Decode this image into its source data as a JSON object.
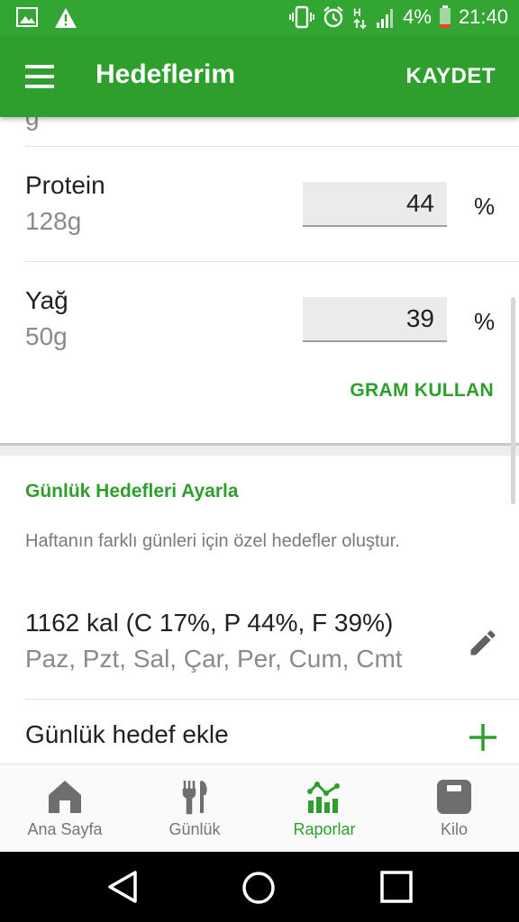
{
  "status": {
    "battery": "4%",
    "time": "21:40"
  },
  "appbar": {
    "title": "Hedeflerim",
    "save": "KAYDET"
  },
  "partial_row": {
    "sub": "g"
  },
  "macros": [
    {
      "name": "Protein",
      "grams": "128g",
      "value": "44",
      "unit": "%"
    },
    {
      "name": "Yağ",
      "grams": "50g",
      "value": "39",
      "unit": "%"
    }
  ],
  "gram_button": "GRAM KULLAN",
  "daily": {
    "title": "Günlük Hedefleri Ayarla",
    "description": "Haftanın farklı günleri için özel hedefler oluştur.",
    "goal_summary": "1162 kal (C 17%, P 44%, F 39%)",
    "goal_days": "Paz, Pzt, Sal, Çar, Per, Cum, Cmt",
    "add_label": "Günlük hedef ekle"
  },
  "bottom_nav": [
    {
      "label": "Ana Sayfa",
      "icon": "home-icon"
    },
    {
      "label": "Günlük",
      "icon": "fork-knife-icon"
    },
    {
      "label": "Raporlar",
      "icon": "reports-chart-icon"
    },
    {
      "label": "Kilo",
      "icon": "scale-icon"
    }
  ],
  "colors": {
    "primary": "#2e9f2d",
    "statusbar": "#33a532"
  }
}
